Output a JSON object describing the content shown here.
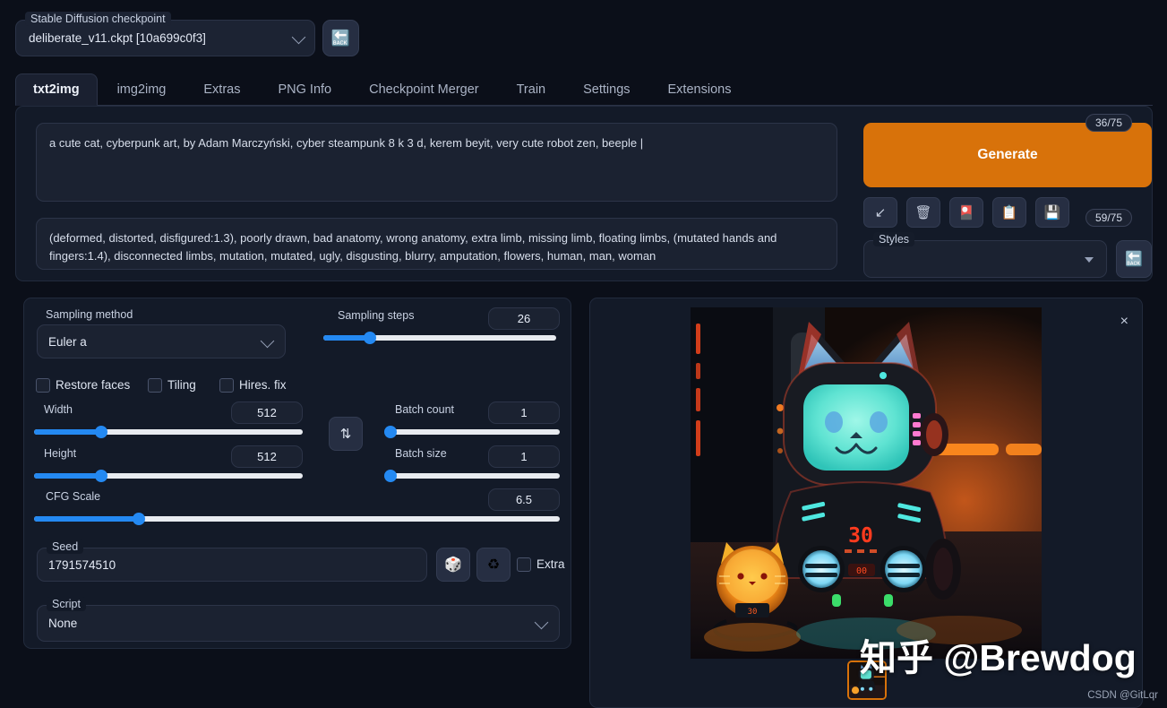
{
  "checkpoint": {
    "label": "Stable Diffusion checkpoint",
    "value": "deliberate_v11.ckpt [10a699c0f3]",
    "refresh_icon": "🔙"
  },
  "tabs": [
    {
      "label": "txt2img",
      "active": true
    },
    {
      "label": "img2img",
      "active": false
    },
    {
      "label": "Extras",
      "active": false
    },
    {
      "label": "PNG Info",
      "active": false
    },
    {
      "label": "Checkpoint Merger",
      "active": false
    },
    {
      "label": "Train",
      "active": false
    },
    {
      "label": "Settings",
      "active": false
    },
    {
      "label": "Extensions",
      "active": false
    }
  ],
  "prompt": {
    "positive": "a cute cat, cyberpunk art, by Adam Marczyński, cyber steampunk 8 k 3 d, kerem beyit, very cute robot zen, beeple |",
    "positive_tokens": "36/75",
    "negative": "(deformed, distorted, disfigured:1.3), poorly drawn, bad anatomy, wrong anatomy, extra limb, missing limb, floating limbs, (mutated hands and fingers:1.4), disconnected limbs, mutation, mutated, ugly, disgusting, blurry, amputation, flowers, human, man, woman",
    "negative_tokens": "59/75"
  },
  "actions": {
    "generate_label": "Generate",
    "icons": [
      {
        "name": "arrow-down-left-icon",
        "glyph": "↙"
      },
      {
        "name": "wastebasket-icon",
        "glyph": "🗑"
      },
      {
        "name": "flower-playing-cards-icon",
        "glyph": "🎴"
      },
      {
        "name": "clipboard-icon",
        "glyph": "📋"
      },
      {
        "name": "floppy-disk-icon",
        "glyph": "💾"
      }
    ],
    "styles_label": "Styles",
    "styles_value": "",
    "styles_refresh_icon": "🔙"
  },
  "settings": {
    "sampling_method": {
      "label": "Sampling method",
      "value": "Euler a"
    },
    "sampling_steps": {
      "label": "Sampling steps",
      "value": "26",
      "percent": 20
    },
    "checkboxes": [
      {
        "label": "Restore faces",
        "checked": false
      },
      {
        "label": "Tiling",
        "checked": false
      },
      {
        "label": "Hires. fix",
        "checked": false
      }
    ],
    "width": {
      "label": "Width",
      "value": "512",
      "percent": 25
    },
    "height": {
      "label": "Height",
      "value": "512",
      "percent": 25
    },
    "cfg_scale": {
      "label": "CFG Scale",
      "value": "6.5",
      "percent": 20
    },
    "batch_count": {
      "label": "Batch count",
      "value": "1",
      "percent": 0
    },
    "batch_size": {
      "label": "Batch size",
      "value": "1",
      "percent": 0
    },
    "swap_icon": "⇅",
    "seed": {
      "label": "Seed",
      "value": "1791574510"
    },
    "seed_random_icon": "🎲",
    "seed_recycle_icon": "♻",
    "extra_label": "Extra",
    "extra_checked": false,
    "script": {
      "label": "Script",
      "value": "None"
    }
  },
  "output": {
    "close_icon": "×",
    "thumbnail_selected": true
  },
  "watermarks": {
    "zhihu": "知乎 @Brewdog",
    "csdn": "CSDN @GitLqr"
  },
  "colors": {
    "accent_orange": "#d8720a",
    "slider_blue": "#2489f2",
    "page_bg": "#0b0f19",
    "panel_bg": "#131a28"
  }
}
